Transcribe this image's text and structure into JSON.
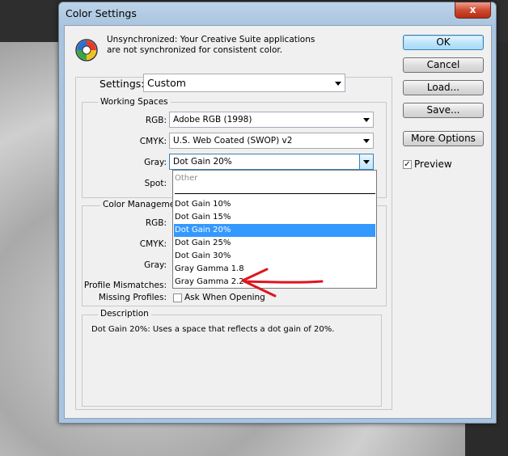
{
  "dialog": {
    "title": "Color Settings",
    "close_label": "x"
  },
  "sync_message": "Unsynchronized: Your Creative Suite applications are not synchronized for consistent color.",
  "settings": {
    "label": "Settings:",
    "value": "Custom"
  },
  "working_spaces": {
    "title": "Working Spaces",
    "rgb_label": "RGB:",
    "rgb_value": "Adobe RGB (1998)",
    "cmyk_label": "CMYK:",
    "cmyk_value": "U.S. Web Coated (SWOP) v2",
    "gray_label": "Gray:",
    "gray_value": "Dot Gain 20%",
    "spot_label": "Spot:"
  },
  "policies": {
    "title": "Color Management",
    "rgb_label": "RGB:",
    "cmyk_label": "CMYK:",
    "gray_label": "Gray:",
    "profile_mismatches_label": "Profile Mismatches:",
    "missing_profiles_label": "Missing Profiles:",
    "ask_when_opening": "Ask When Opening"
  },
  "gray_dropdown": {
    "header": "Other",
    "options": [
      "Dot Gain 10%",
      "Dot Gain 15%",
      "Dot Gain 20%",
      "Dot Gain 25%",
      "Dot Gain 30%",
      "Gray Gamma 1.8",
      "Gray Gamma 2.2"
    ],
    "selected": "Dot Gain 20%"
  },
  "description": {
    "title": "Description",
    "text": "Dot Gain 20%:  Uses a space that reflects a dot gain of 20%."
  },
  "buttons": {
    "ok": "OK",
    "cancel": "Cancel",
    "load": "Load...",
    "save": "Save...",
    "more_options": "More Options"
  },
  "preview": {
    "label": "Preview",
    "checked": true
  },
  "colors": {
    "selection": "#3399ff",
    "annotation": "#e0141e"
  }
}
